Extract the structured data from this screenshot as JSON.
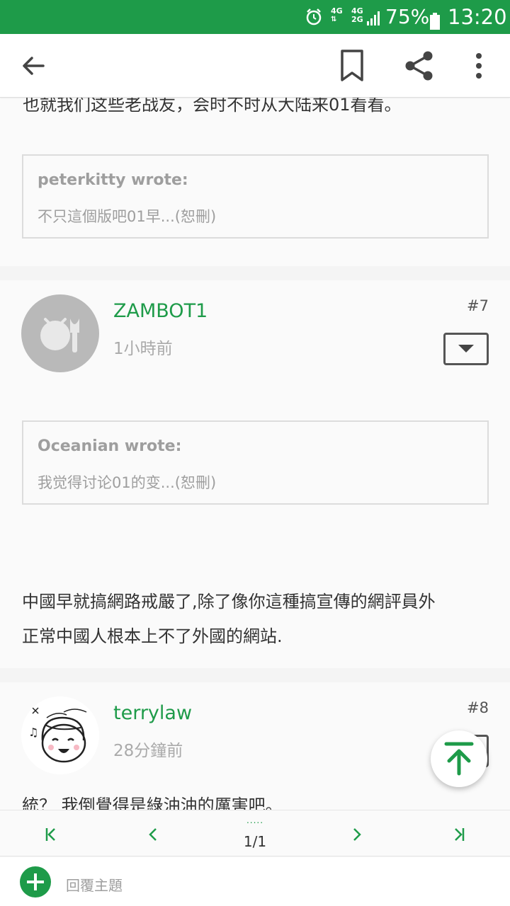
{
  "status_bar": {
    "network_top": "4G",
    "network_bottom": "4G",
    "network_2g": "2G",
    "battery": "75%",
    "time": "13:20"
  },
  "app_bar": {
    "icons": [
      "arrow-left-icon",
      "bookmark-icon",
      "share-icon",
      "more-vert-icon"
    ]
  },
  "posts": [
    {
      "partial_text": "也就我们这些老战友，会时不时从大陆来01看看。",
      "quote": {
        "author": "peterkitty wrote:",
        "text": "不只這個版吧01早...(恕刪)"
      }
    },
    {
      "username": "ZAMBOT1",
      "time": "1小時前",
      "number": "#7",
      "quote": {
        "author": "Oceanian wrote:",
        "text": "我觉得讨论01的变...(恕刪)"
      },
      "body": [
        "中國早就搞網路戒嚴了,除了像你這種搞宣傳的網評員外",
        "正常中國人根本上不了外國的網站."
      ]
    },
    {
      "username": "terrylaw",
      "time": "28分鐘前",
      "number": "#8",
      "body_partial": "統？ 我倒覺得是綠油油的厲害吧。"
    }
  ],
  "pagination": {
    "dots": ".....",
    "label": "1/1"
  },
  "reply": {
    "label": "回覆主題"
  },
  "colors": {
    "accent": "#1e9b49",
    "background": "#f4f4f4",
    "card": "#fafafa"
  }
}
